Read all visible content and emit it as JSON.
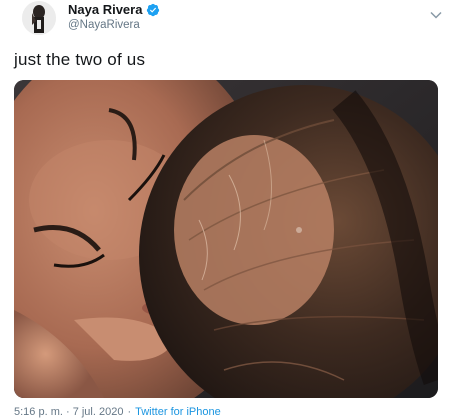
{
  "user": {
    "display_name": "Naya Rivera",
    "handle": "@NayaRivera",
    "verified": true,
    "avatar_icon": "profile-avatar"
  },
  "tweet": {
    "text": "just the two of us",
    "media_alt": "photo",
    "timestamp": "5:16 p. m. · 7 jul. 2020",
    "separator": "·",
    "source": "Twitter for iPhone"
  },
  "icons": {
    "verified": "verified-badge-icon",
    "more": "chevron-down-icon"
  },
  "colors": {
    "link": "#1b95e0",
    "verified": "#1da1f2",
    "secondary_text": "#657786"
  }
}
